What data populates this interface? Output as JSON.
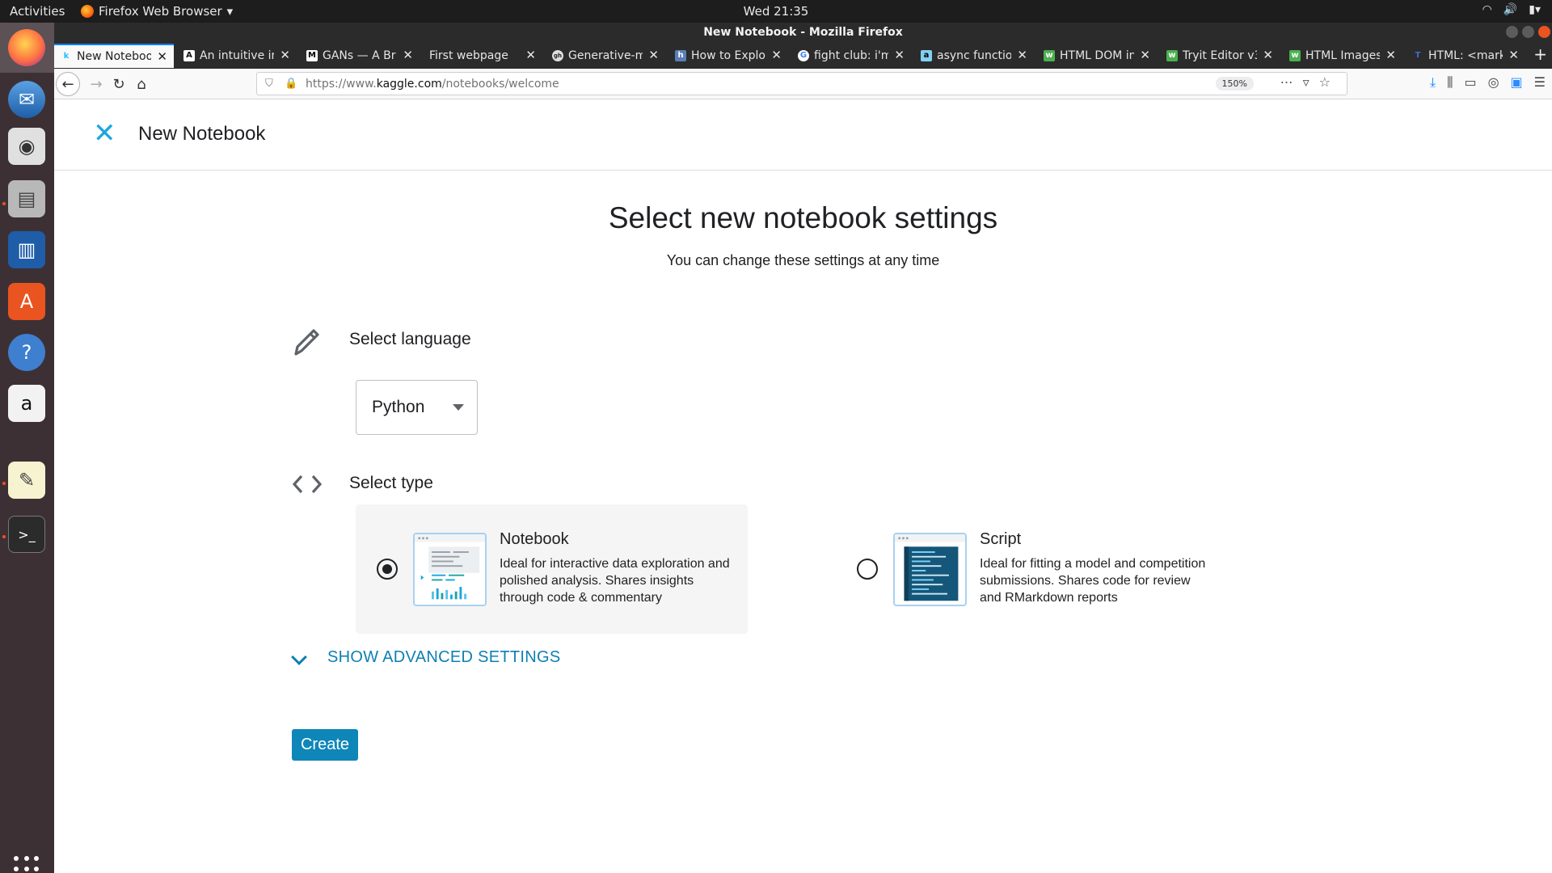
{
  "system_bar": {
    "activities": "Activities",
    "app_menu": "Firefox Web Browser",
    "clock": "Wed 21:35"
  },
  "window": {
    "title": "New Notebook - Mozilla Firefox"
  },
  "tabs": [
    {
      "title": "New Notebook",
      "favicon": "k",
      "active": true
    },
    {
      "title": "An intuitive in",
      "favicon": "A"
    },
    {
      "title": "GANs — A Br",
      "favicon": "M"
    },
    {
      "title": "First webpage",
      "favicon": ""
    },
    {
      "title": "Generative-m",
      "favicon": "gh"
    },
    {
      "title": "How to Explo",
      "favicon": "h"
    },
    {
      "title": "fight club: i'm",
      "favicon": "G"
    },
    {
      "title": "async functio",
      "favicon": "a"
    },
    {
      "title": "HTML DOM in",
      "favicon": "w"
    },
    {
      "title": "Tryit Editor v3",
      "favicon": "w"
    },
    {
      "title": "HTML Images",
      "favicon": "w"
    },
    {
      "title": "HTML: <mark",
      "favicon": "T"
    }
  ],
  "navigation": {
    "url_prefix": "https://www.",
    "url_host": "kaggle.com",
    "url_path": "/notebooks/welcome",
    "zoom": "150%"
  },
  "page": {
    "header_title": "New Notebook",
    "heading": "Select new notebook settings",
    "subheading": "You can change these settings at any time",
    "language_label": "Select language",
    "language_value": "Python",
    "type_label": "Select type",
    "types": [
      {
        "title": "Notebook",
        "description": "Ideal for interactive data exploration and polished analysis. Shares insights through code & commentary",
        "selected": true
      },
      {
        "title": "Script",
        "description": "Ideal for fitting a model and competition submissions. Shares code for review and RMarkdown reports",
        "selected": false
      }
    ],
    "advanced_label": "SHOW ADVANCED SETTINGS",
    "create_label": "Create"
  },
  "colors": {
    "accent": "#0e86b8",
    "close_icon": "#1aa7e0",
    "selected_card_bg": "#f5f5f5",
    "dock_bg": "#3d3034",
    "ubuntu_orange": "#e95420"
  },
  "icons": {
    "close": "close-icon",
    "language": "pencil-icon",
    "type": "code-brackets-icon",
    "advanced": "chevron-down-icon"
  }
}
